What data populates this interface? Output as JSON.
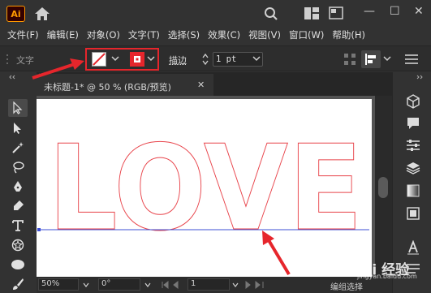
{
  "app": {
    "logo": "Ai",
    "window_controls": [
      "—",
      "☐",
      "✕"
    ]
  },
  "menu": [
    "文件(F)",
    "编辑(E)",
    "对象(O)",
    "文字(T)",
    "选择(S)",
    "效果(C)",
    "视图(V)",
    "窗口(W)",
    "帮助(H)"
  ],
  "control": {
    "context_label": "文字",
    "stroke_label": "描边",
    "stroke_value": "1 pt"
  },
  "document": {
    "tab_title": "未标题-1* @ 50 % (RGB/预览)",
    "close": "✕"
  },
  "canvas": {
    "text": "LOVE",
    "text_stroke_color": "#e8434a",
    "baseline_color": "#3d4fd6"
  },
  "status": {
    "zoom": "50%",
    "rotation": "0°",
    "artboard": "1",
    "mode": "编组选择"
  },
  "watermark": {
    "main": "Bai 经验",
    "sub": "jingyan.baidu.com"
  },
  "colors": {
    "annotation": "#e6262c",
    "ui_bg": "#323232"
  }
}
